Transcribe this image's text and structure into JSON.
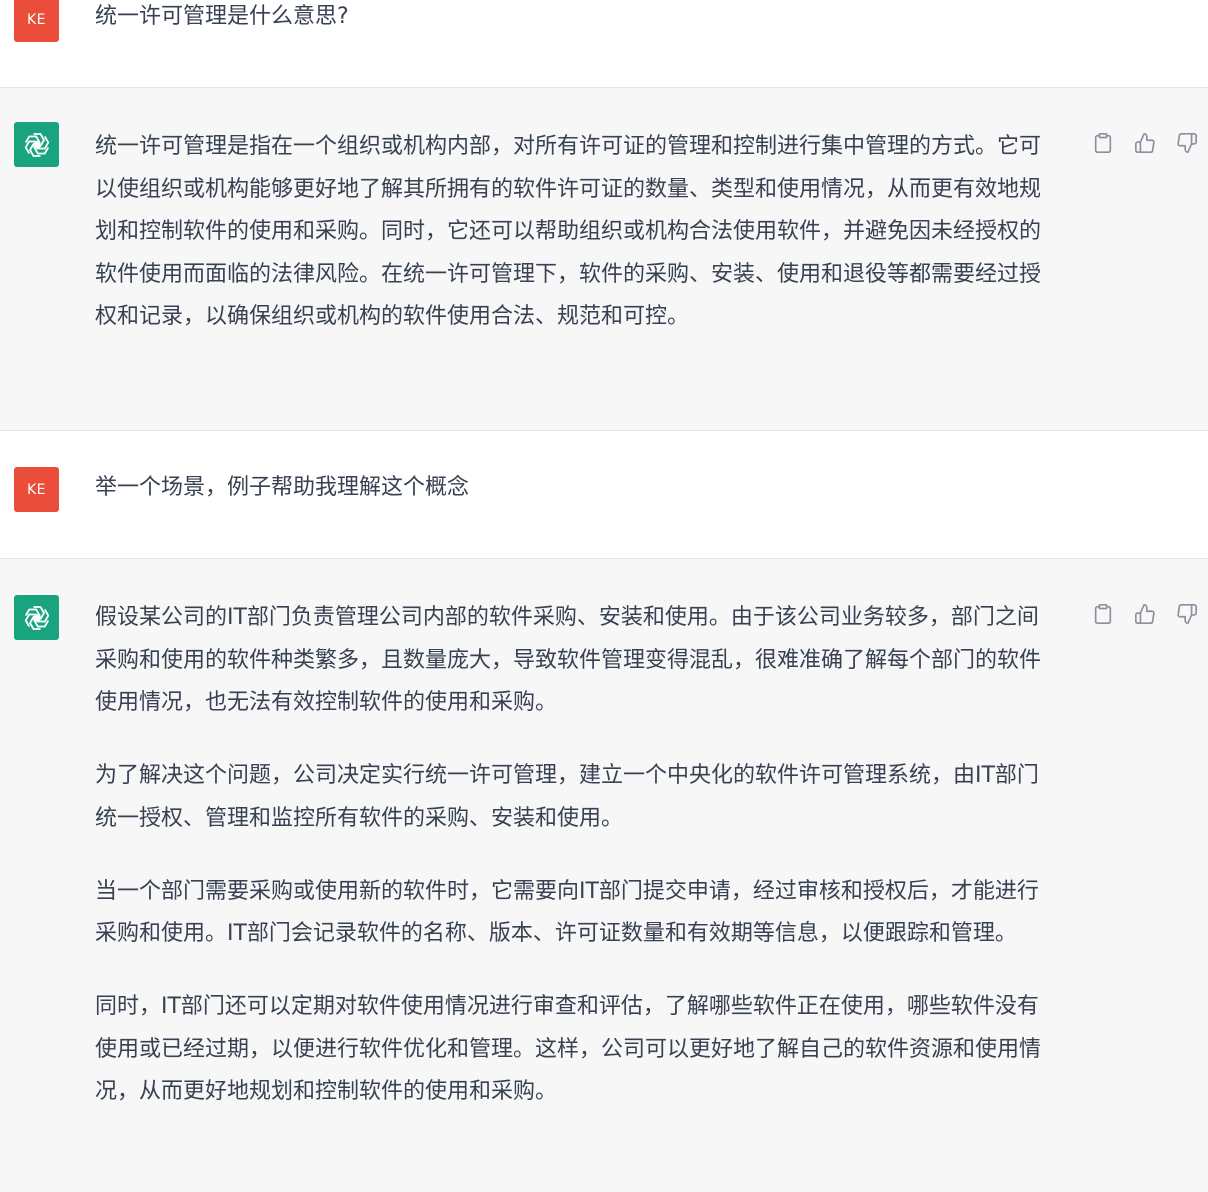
{
  "conversation": [
    {
      "role": "user",
      "avatar_initials": "KE",
      "paragraphs": [
        "统一许可管理是什么意思?"
      ]
    },
    {
      "role": "assistant",
      "paragraphs": [
        "统一许可管理是指在一个组织或机构内部，对所有许可证的管理和控制进行集中管理的方式。它可以使组织或机构能够更好地了解其所拥有的软件许可证的数量、类型和使用情况，从而更有效地规划和控制软件的使用和采购。同时，它还可以帮助组织或机构合法使用软件，并避免因未经授权的软件使用而面临的法律风险。在统一许可管理下，软件的采购、安装、使用和退役等都需要经过授权和记录，以确保组织或机构的软件使用合法、规范和可控。"
      ]
    },
    {
      "role": "user",
      "avatar_initials": "KE",
      "paragraphs": [
        "举一个场景，例子帮助我理解这个概念"
      ]
    },
    {
      "role": "assistant",
      "paragraphs": [
        "假设某公司的IT部门负责管理公司内部的软件采购、安装和使用。由于该公司业务较多，部门之间采购和使用的软件种类繁多，且数量庞大，导致软件管理变得混乱，很难准确了解每个部门的软件使用情况，也无法有效控制软件的使用和采购。",
        "为了解决这个问题，公司决定实行统一许可管理，建立一个中央化的软件许可管理系统，由IT部门统一授权、管理和监控所有软件的采购、安装和使用。",
        "当一个部门需要采购或使用新的软件时，它需要向IT部门提交申请，经过审核和授权后，才能进行采购和使用。IT部门会记录软件的名称、版本、许可证数量和有效期等信息，以便跟踪和管理。",
        "同时，IT部门还可以定期对软件使用情况进行审查和评估，了解哪些软件正在使用，哪些软件没有使用或已经过期，以便进行软件优化和管理。这样，公司可以更好地了解自己的软件资源和使用情况，从而更好地规划和控制软件的使用和采购。"
      ]
    }
  ],
  "icons": {
    "assistant_avatar": "openai-logo-icon",
    "copy": "clipboard-icon",
    "like": "thumbs-up-icon",
    "dislike": "thumbs-down-icon"
  },
  "colors": {
    "user_avatar_bg": "#ea4e3a",
    "assistant_avatar_bg": "#19a37f",
    "assistant_row_bg": "#f7f7f8",
    "user_row_bg": "#ffffff",
    "text": "#374151",
    "icon": "#8e8ea0"
  }
}
